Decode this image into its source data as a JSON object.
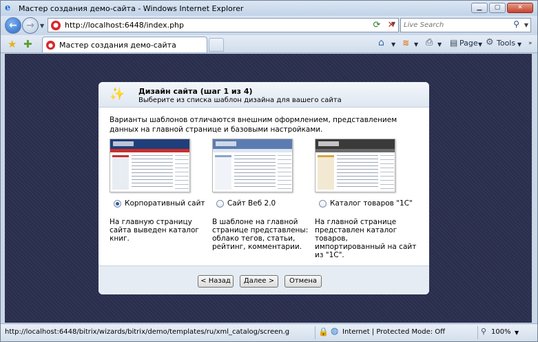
{
  "window": {
    "title": "Мастер создания демо-сайта - Windows Internet Explorer",
    "controls": {
      "minimize": "▁",
      "maximize": "▢",
      "close": "✕"
    }
  },
  "address": {
    "url": "http://localhost:6448/index.php",
    "search_placeholder": "Live Search"
  },
  "tabs": [
    {
      "label": "Мастер создания демо-сайта",
      "active": true
    }
  ],
  "command_bar": {
    "page": "Page",
    "tools": "Tools"
  },
  "wizard": {
    "title": "Дизайн сайта (шаг 1 из 4)",
    "subtitle": "Выберите из списка шаблон дизайна для вашего сайта",
    "description": "Варианты шаблонов отличаются внешним оформлением, представлением данных на главной странице и базовыми настройками.",
    "templates": [
      {
        "label": "Корпоративный сайт",
        "selected": true,
        "note": "На главную страницу сайта выведен каталог книг."
      },
      {
        "label": "Сайт Веб 2.0",
        "selected": false,
        "note": "В шаблоне на главной странице представлены: облако тегов, статьи, рейтинг, комментарии."
      },
      {
        "label": "Каталог товаров \"1С\"",
        "selected": false,
        "note": "На главной странице представлен каталог товаров, импортированный на сайт из \"1С\"."
      }
    ],
    "buttons": {
      "back": "< Назад",
      "next": "Далее >",
      "cancel": "Отмена"
    }
  },
  "status": {
    "url": "http://localhost:6448/bitrix/wizards/bitrix/demo/templates/ru/xml_catalog/screen.g",
    "zone": "Internet | Protected Mode: Off",
    "zoom": "100%"
  },
  "colors": {
    "page_background": "#2b2f4e",
    "radio_selected": "#2b5aa8"
  },
  "icons": [
    "ie-icon",
    "back-arrow-icon",
    "forward-arrow-icon",
    "refresh-icon",
    "stop-icon",
    "search-icon",
    "favorites-star-icon",
    "add-favorites-icon",
    "home-icon",
    "feeds-icon",
    "print-icon",
    "page-icon",
    "tools-gear-icon",
    "wizard-wand-icon",
    "lock-icon",
    "globe-icon",
    "zoom-icon"
  ]
}
